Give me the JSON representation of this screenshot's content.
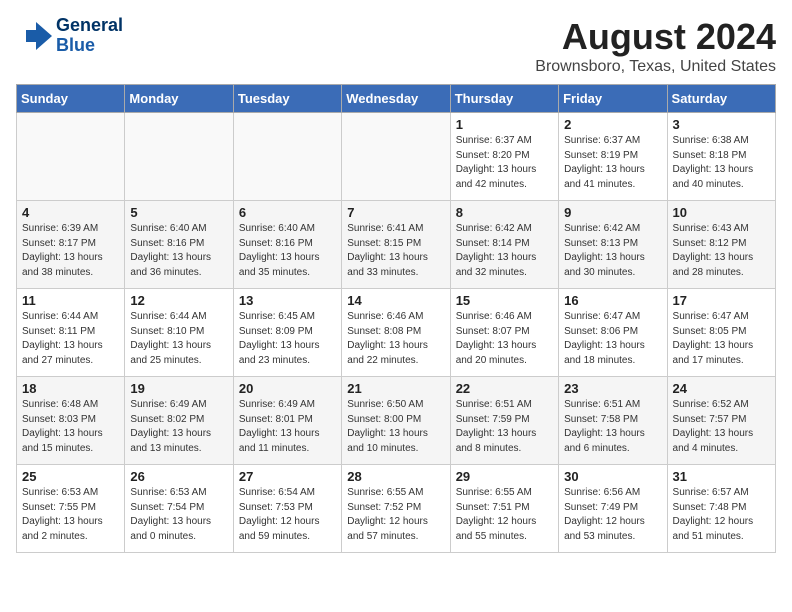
{
  "header": {
    "logo_line1": "General",
    "logo_line2": "Blue",
    "month": "August 2024",
    "location": "Brownsboro, Texas, United States"
  },
  "days_of_week": [
    "Sunday",
    "Monday",
    "Tuesday",
    "Wednesday",
    "Thursday",
    "Friday",
    "Saturday"
  ],
  "weeks": [
    [
      {
        "day": "",
        "info": ""
      },
      {
        "day": "",
        "info": ""
      },
      {
        "day": "",
        "info": ""
      },
      {
        "day": "",
        "info": ""
      },
      {
        "day": "1",
        "info": "Sunrise: 6:37 AM\nSunset: 8:20 PM\nDaylight: 13 hours\nand 42 minutes."
      },
      {
        "day": "2",
        "info": "Sunrise: 6:37 AM\nSunset: 8:19 PM\nDaylight: 13 hours\nand 41 minutes."
      },
      {
        "day": "3",
        "info": "Sunrise: 6:38 AM\nSunset: 8:18 PM\nDaylight: 13 hours\nand 40 minutes."
      }
    ],
    [
      {
        "day": "4",
        "info": "Sunrise: 6:39 AM\nSunset: 8:17 PM\nDaylight: 13 hours\nand 38 minutes."
      },
      {
        "day": "5",
        "info": "Sunrise: 6:40 AM\nSunset: 8:16 PM\nDaylight: 13 hours\nand 36 minutes."
      },
      {
        "day": "6",
        "info": "Sunrise: 6:40 AM\nSunset: 8:16 PM\nDaylight: 13 hours\nand 35 minutes."
      },
      {
        "day": "7",
        "info": "Sunrise: 6:41 AM\nSunset: 8:15 PM\nDaylight: 13 hours\nand 33 minutes."
      },
      {
        "day": "8",
        "info": "Sunrise: 6:42 AM\nSunset: 8:14 PM\nDaylight: 13 hours\nand 32 minutes."
      },
      {
        "day": "9",
        "info": "Sunrise: 6:42 AM\nSunset: 8:13 PM\nDaylight: 13 hours\nand 30 minutes."
      },
      {
        "day": "10",
        "info": "Sunrise: 6:43 AM\nSunset: 8:12 PM\nDaylight: 13 hours\nand 28 minutes."
      }
    ],
    [
      {
        "day": "11",
        "info": "Sunrise: 6:44 AM\nSunset: 8:11 PM\nDaylight: 13 hours\nand 27 minutes."
      },
      {
        "day": "12",
        "info": "Sunrise: 6:44 AM\nSunset: 8:10 PM\nDaylight: 13 hours\nand 25 minutes."
      },
      {
        "day": "13",
        "info": "Sunrise: 6:45 AM\nSunset: 8:09 PM\nDaylight: 13 hours\nand 23 minutes."
      },
      {
        "day": "14",
        "info": "Sunrise: 6:46 AM\nSunset: 8:08 PM\nDaylight: 13 hours\nand 22 minutes."
      },
      {
        "day": "15",
        "info": "Sunrise: 6:46 AM\nSunset: 8:07 PM\nDaylight: 13 hours\nand 20 minutes."
      },
      {
        "day": "16",
        "info": "Sunrise: 6:47 AM\nSunset: 8:06 PM\nDaylight: 13 hours\nand 18 minutes."
      },
      {
        "day": "17",
        "info": "Sunrise: 6:47 AM\nSunset: 8:05 PM\nDaylight: 13 hours\nand 17 minutes."
      }
    ],
    [
      {
        "day": "18",
        "info": "Sunrise: 6:48 AM\nSunset: 8:03 PM\nDaylight: 13 hours\nand 15 minutes."
      },
      {
        "day": "19",
        "info": "Sunrise: 6:49 AM\nSunset: 8:02 PM\nDaylight: 13 hours\nand 13 minutes."
      },
      {
        "day": "20",
        "info": "Sunrise: 6:49 AM\nSunset: 8:01 PM\nDaylight: 13 hours\nand 11 minutes."
      },
      {
        "day": "21",
        "info": "Sunrise: 6:50 AM\nSunset: 8:00 PM\nDaylight: 13 hours\nand 10 minutes."
      },
      {
        "day": "22",
        "info": "Sunrise: 6:51 AM\nSunset: 7:59 PM\nDaylight: 13 hours\nand 8 minutes."
      },
      {
        "day": "23",
        "info": "Sunrise: 6:51 AM\nSunset: 7:58 PM\nDaylight: 13 hours\nand 6 minutes."
      },
      {
        "day": "24",
        "info": "Sunrise: 6:52 AM\nSunset: 7:57 PM\nDaylight: 13 hours\nand 4 minutes."
      }
    ],
    [
      {
        "day": "25",
        "info": "Sunrise: 6:53 AM\nSunset: 7:55 PM\nDaylight: 13 hours\nand 2 minutes."
      },
      {
        "day": "26",
        "info": "Sunrise: 6:53 AM\nSunset: 7:54 PM\nDaylight: 13 hours\nand 0 minutes."
      },
      {
        "day": "27",
        "info": "Sunrise: 6:54 AM\nSunset: 7:53 PM\nDaylight: 12 hours\nand 59 minutes."
      },
      {
        "day": "28",
        "info": "Sunrise: 6:55 AM\nSunset: 7:52 PM\nDaylight: 12 hours\nand 57 minutes."
      },
      {
        "day": "29",
        "info": "Sunrise: 6:55 AM\nSunset: 7:51 PM\nDaylight: 12 hours\nand 55 minutes."
      },
      {
        "day": "30",
        "info": "Sunrise: 6:56 AM\nSunset: 7:49 PM\nDaylight: 12 hours\nand 53 minutes."
      },
      {
        "day": "31",
        "info": "Sunrise: 6:57 AM\nSunset: 7:48 PM\nDaylight: 12 hours\nand 51 minutes."
      }
    ]
  ]
}
